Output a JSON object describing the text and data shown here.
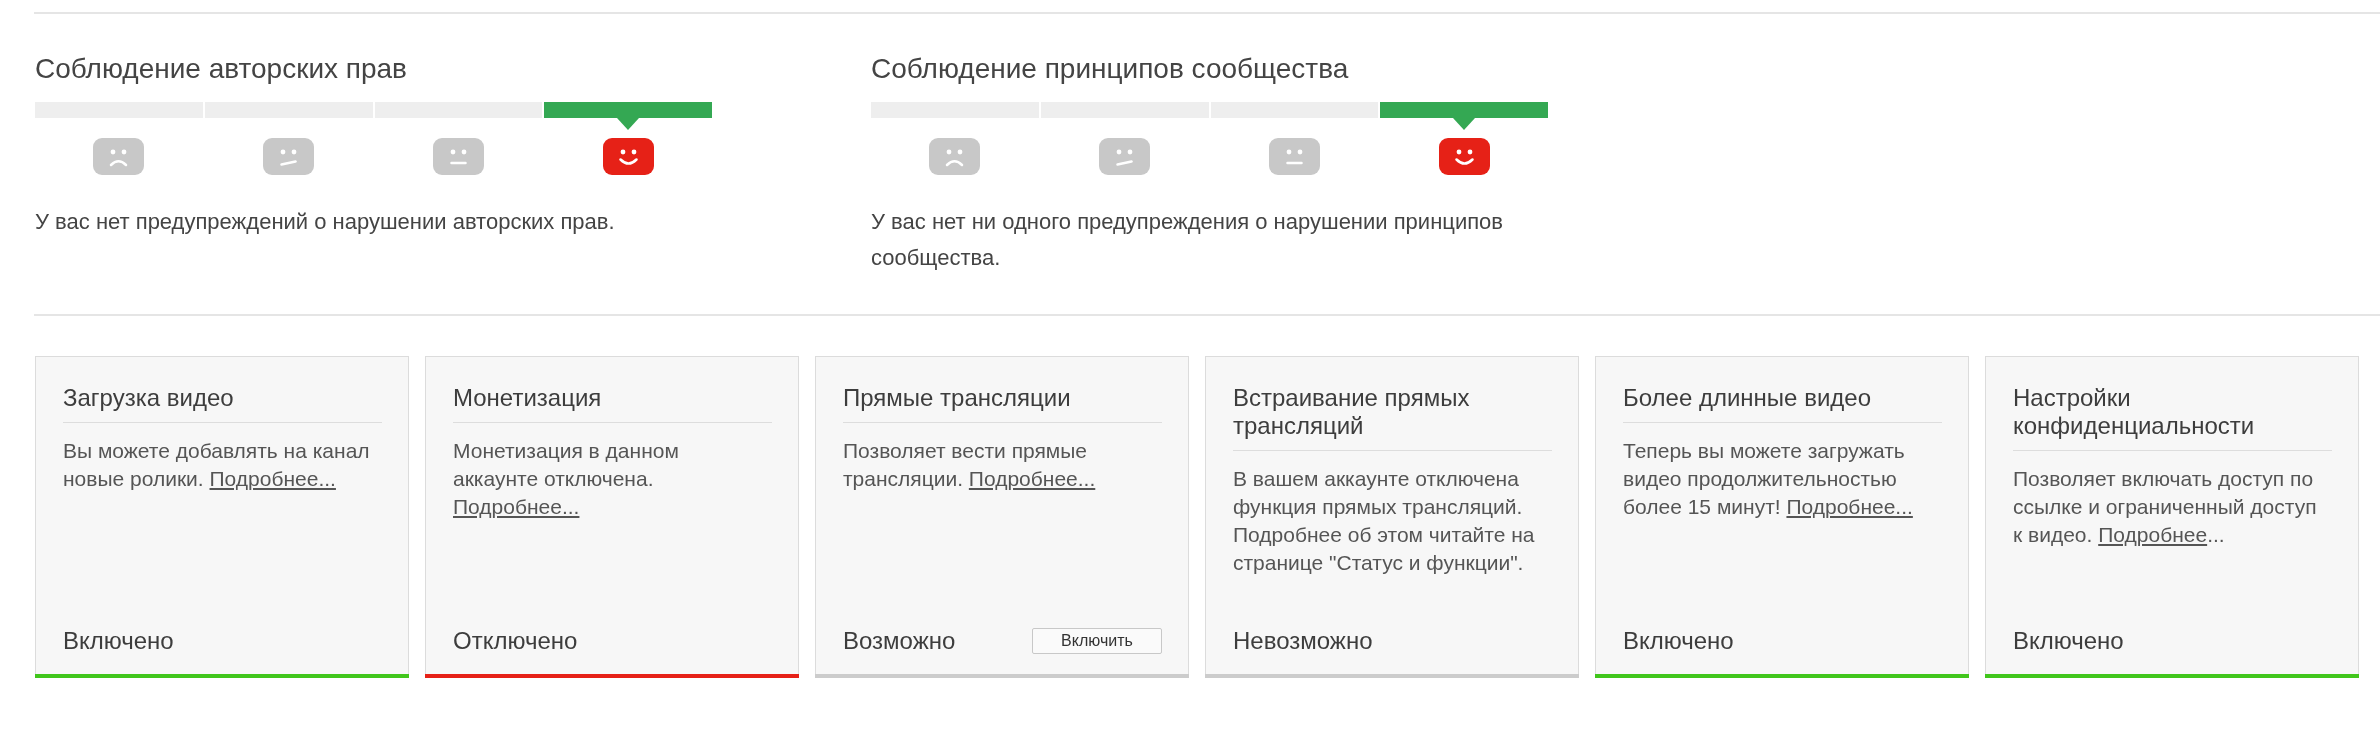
{
  "sections": [
    {
      "title": "Соблюдение авторских прав",
      "steps": [
        {
          "kind": "frown",
          "selected": false
        },
        {
          "kind": "smirk",
          "selected": false
        },
        {
          "kind": "neutral",
          "selected": false
        },
        {
          "kind": "smile",
          "selected": true
        }
      ],
      "message": "У вас нет предупреждений о нарушении авторских прав."
    },
    {
      "title": "Соблюдение принципов сообщества",
      "steps": [
        {
          "kind": "frown",
          "selected": false
        },
        {
          "kind": "smirk",
          "selected": false
        },
        {
          "kind": "neutral",
          "selected": false
        },
        {
          "kind": "smile",
          "selected": true
        }
      ],
      "message": "У вас нет ни одного предупреждения о нарушении принципов сообщества."
    }
  ],
  "features": [
    {
      "title": "Загрузка видео",
      "description": "Вы можете добавлять на канал новые ролики.",
      "link": "Подробнее...",
      "status": "Включено",
      "color": "#41c61c"
    },
    {
      "title": "Монетизация",
      "description": "Монетизация в данном аккаунте отключена.",
      "link": "Подробнее...",
      "status": "Отключено",
      "color": "#e62117"
    },
    {
      "title": "Прямые трансляции",
      "description": "Позволяет вести прямые трансляции.",
      "link": "Подробнее...",
      "status": "Возможно",
      "button": "Включить",
      "color": "#cccccc"
    },
    {
      "title": "Встраивание прямых трансляций",
      "description": "В вашем аккаунте отключена функция прямых трансляций. Подробнее об этом читайте на странице \"Статус и функции\".",
      "status": "Невозможно",
      "color": "#cccccc"
    },
    {
      "title": "Более длинные видео",
      "description": "Теперь вы можете загружать видео продолжительностью более 15 минут!",
      "link": "Подробнее...",
      "status": "Включено",
      "color": "#41c61c"
    },
    {
      "title": "Настройки конфиденциальности",
      "description": "Позволяет включать доступ по ссылке и ограниченный доступ к видео.",
      "link": "Подробнее",
      "link_tail": "...",
      "status": "Включено",
      "color": "#41c61c"
    }
  ]
}
